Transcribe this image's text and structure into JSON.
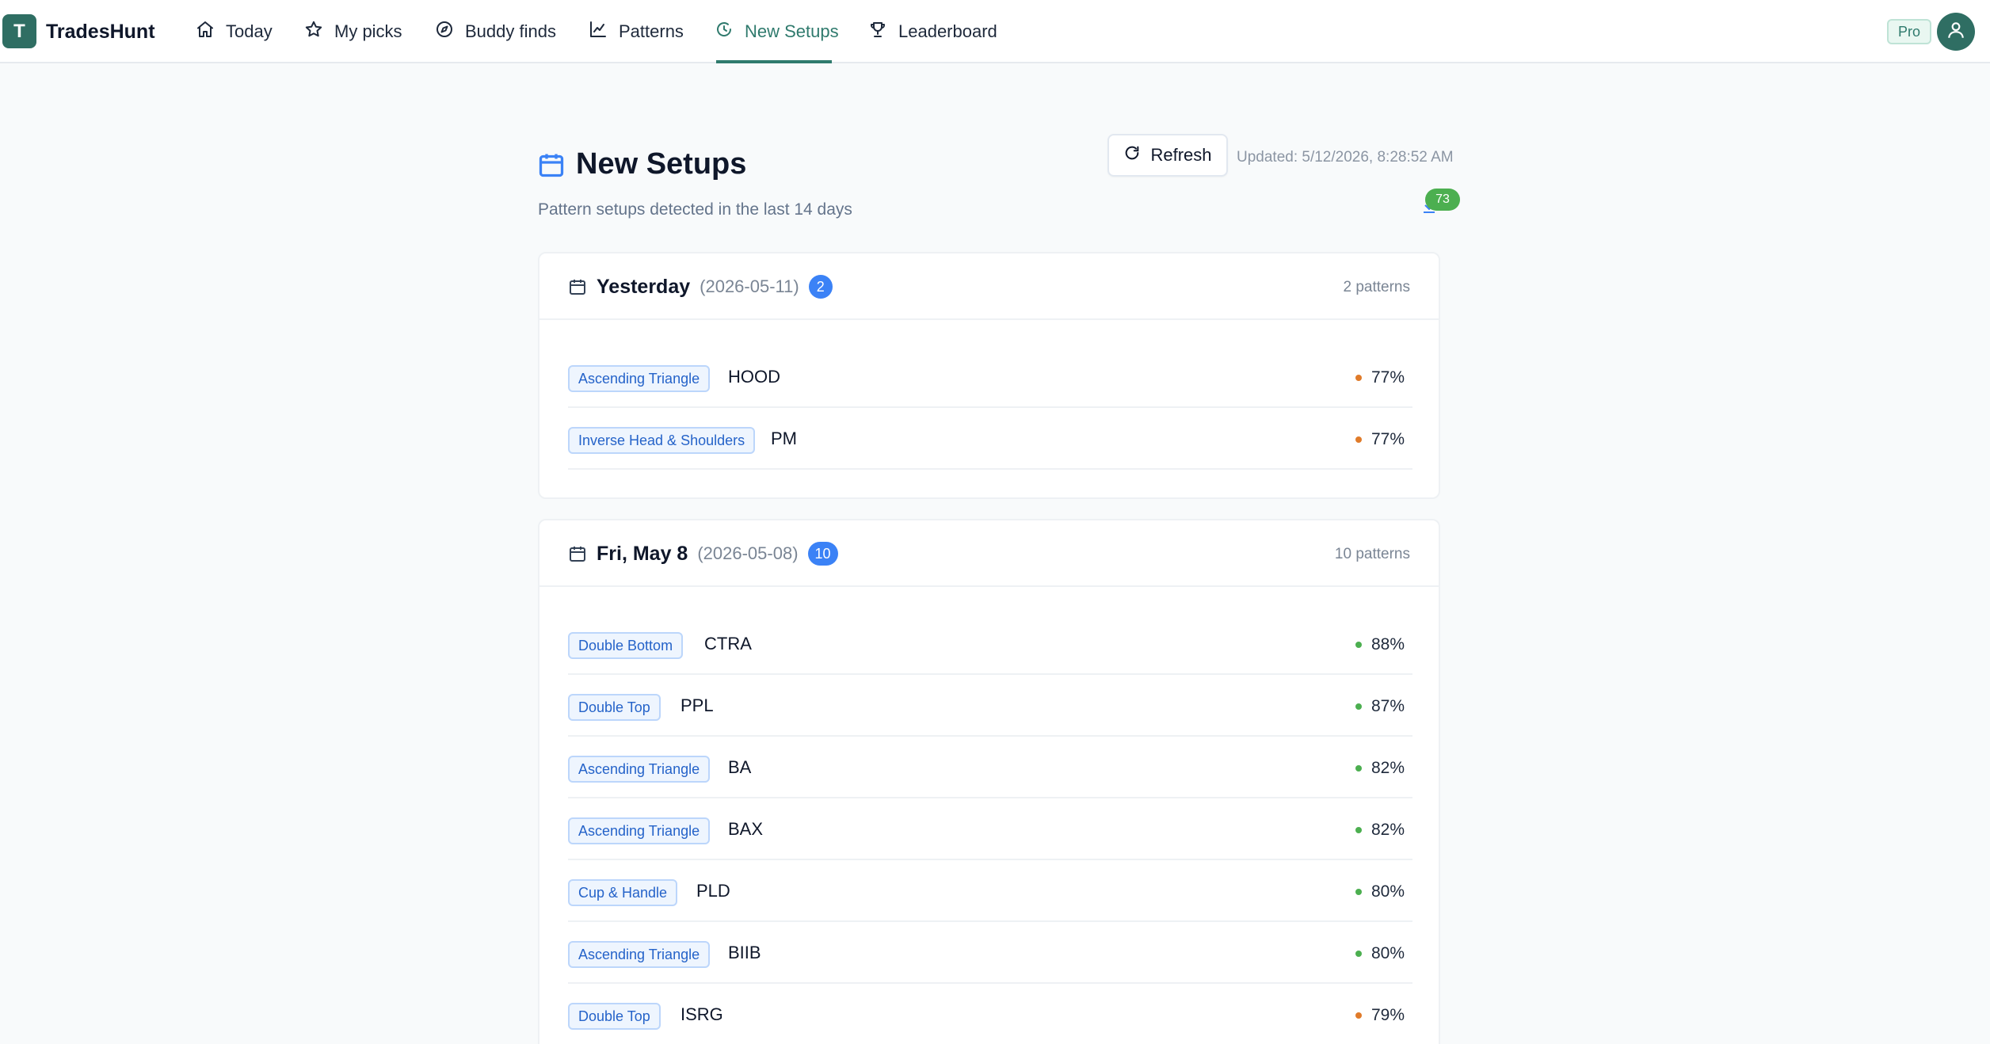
{
  "brand": {
    "logo_letter": "T",
    "name": "TradesHunt"
  },
  "nav": [
    {
      "label": "Today",
      "icon": "home-icon"
    },
    {
      "label": "My picks",
      "icon": "star-icon"
    },
    {
      "label": "Buddy finds",
      "icon": "compass-icon"
    },
    {
      "label": "Patterns",
      "icon": "chart-line-icon"
    },
    {
      "label": "New Setups",
      "icon": "refresh-clock-icon",
      "active": true
    },
    {
      "label": "Leaderboard",
      "icon": "trophy-icon"
    }
  ],
  "account": {
    "plan_badge": "Pro",
    "avatar_icon": "user-icon"
  },
  "header": {
    "title": "New Setups",
    "subtitle": "Pattern setups detected in the last 14 days",
    "refresh_label": "Refresh",
    "updated": "Updated: 5/12/2026, 8:28:52 AM",
    "notif_count": "73"
  },
  "colors": {
    "brand": "#2f6e63",
    "accent_blue": "#3b82f6",
    "high_conf": "#4caf50",
    "mid_conf": "#e07b2a"
  },
  "groups": [
    {
      "title": "Yesterday",
      "date": "(2026-05-11)",
      "count": "2",
      "patterns_label": "2 patterns",
      "rows": [
        {
          "pattern": "Ascending Triangle",
          "ticker": "HOOD",
          "confidence": "77%",
          "level": "mid"
        },
        {
          "pattern": "Inverse Head & Shoulders",
          "ticker": "PM",
          "confidence": "77%",
          "level": "mid"
        }
      ]
    },
    {
      "title": "Fri, May 8",
      "date": "(2026-05-08)",
      "count": "10",
      "patterns_label": "10 patterns",
      "rows": [
        {
          "pattern": "Double Bottom",
          "ticker": "CTRA",
          "confidence": "88%",
          "level": "high"
        },
        {
          "pattern": "Double Top",
          "ticker": "PPL",
          "confidence": "87%",
          "level": "high"
        },
        {
          "pattern": "Ascending Triangle",
          "ticker": "BA",
          "confidence": "82%",
          "level": "high"
        },
        {
          "pattern": "Ascending Triangle",
          "ticker": "BAX",
          "confidence": "82%",
          "level": "high"
        },
        {
          "pattern": "Cup & Handle",
          "ticker": "PLD",
          "confidence": "80%",
          "level": "high"
        },
        {
          "pattern": "Ascending Triangle",
          "ticker": "BIIB",
          "confidence": "80%",
          "level": "high"
        },
        {
          "pattern": "Double Top",
          "ticker": "ISRG",
          "confidence": "79%",
          "level": "mid"
        }
      ]
    }
  ]
}
